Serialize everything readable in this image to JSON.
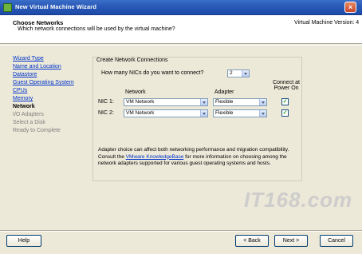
{
  "window": {
    "title": "New Virtual Machine Wizard",
    "close_glyph": "×"
  },
  "header": {
    "title": "Choose Networks",
    "subtitle": "Which network connections will be used by the virtual machine?",
    "version": "Virtual Machine Version: 4"
  },
  "nav": {
    "items": [
      {
        "label": "Wizard Type",
        "state": "link"
      },
      {
        "label": "Name and Location",
        "state": "link"
      },
      {
        "label": "Datastore",
        "state": "link"
      },
      {
        "label": "Guest Operating System",
        "state": "link"
      },
      {
        "label": "CPUs",
        "state": "link"
      },
      {
        "label": "Memory",
        "state": "link"
      },
      {
        "label": "Network",
        "state": "current"
      },
      {
        "label": "I/O Adapters",
        "state": "disabled"
      },
      {
        "label": "Select a Disk",
        "state": "disabled"
      },
      {
        "label": "Ready to Complete",
        "state": "disabled"
      }
    ]
  },
  "panel": {
    "legend": "Create Network Connections",
    "question": "How many NICs do you want to connect?",
    "nic_count": "2",
    "col_network": "Network",
    "col_adapter": "Adapter",
    "col_connect_line1": "Connect at",
    "col_connect_line2": "Power On",
    "nics": [
      {
        "label": "NIC 1:",
        "network": "VM Network",
        "adapter": "Flexible",
        "connect": "✓"
      },
      {
        "label": "NIC 2:",
        "network": "VM Network",
        "adapter": "Flexible",
        "connect": "✓"
      }
    ],
    "info_before": "Adapter choice can affect both networking performance and migration compatibility. Consult the ",
    "info_link": "VMware KnowledgeBase",
    "info_after": " for more information on choosing among the network adapters supported for various guest operating systems and hosts."
  },
  "buttons": {
    "help": "Help",
    "back": "< Back",
    "next": "Next >",
    "cancel": "Cancel"
  },
  "watermark": "IT168.com",
  "colors": {
    "titlebar": "#2a5ab8",
    "link": "#0033cc",
    "dialog_bg": "#ece9d8"
  }
}
